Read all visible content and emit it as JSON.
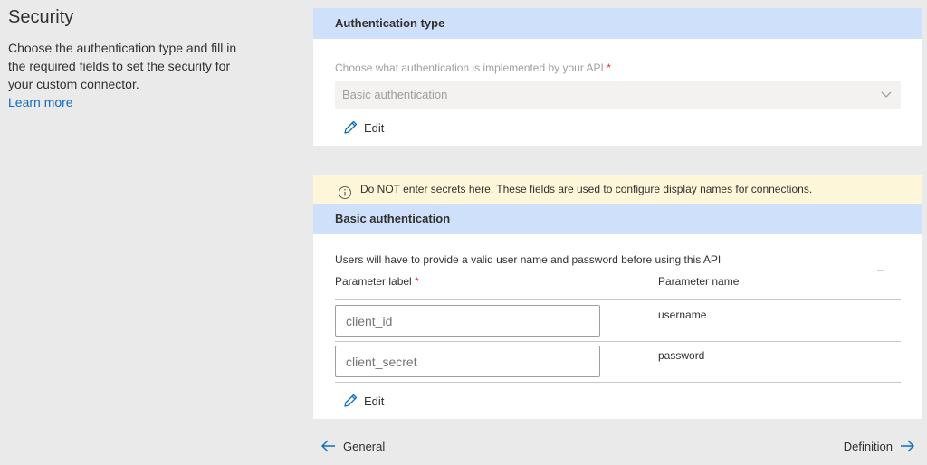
{
  "intro": {
    "title": "Security",
    "description": "Choose the authentication type and fill in the required fields to set the security for your custom connector.",
    "learn_more": "Learn more"
  },
  "auth_type": {
    "header": "Authentication type",
    "field_label": "Choose what authentication is implemented by your API",
    "required_mark": "*",
    "selected_value": "Basic authentication",
    "edit_label": "Edit"
  },
  "warning": {
    "text": "Do NOT enter secrets here. These fields are used to configure display names for connections."
  },
  "basic_auth": {
    "header": "Basic authentication",
    "description": "Users will have to provide a valid user name and password before using this API",
    "col_label": "Parameter label",
    "required_mark": "*",
    "col_name": "Parameter name",
    "rows": [
      {
        "label_placeholder": "client_id",
        "name": "username"
      },
      {
        "label_placeholder": "client_secret",
        "name": "password"
      }
    ],
    "edit_label": "Edit"
  },
  "nav": {
    "back_label": "General",
    "next_label": "Definition"
  },
  "colors": {
    "accent": "#0f6cbd",
    "header_bg": "#cfe0fb",
    "warning_bg": "#fdf6d8",
    "required": "#d13438"
  }
}
